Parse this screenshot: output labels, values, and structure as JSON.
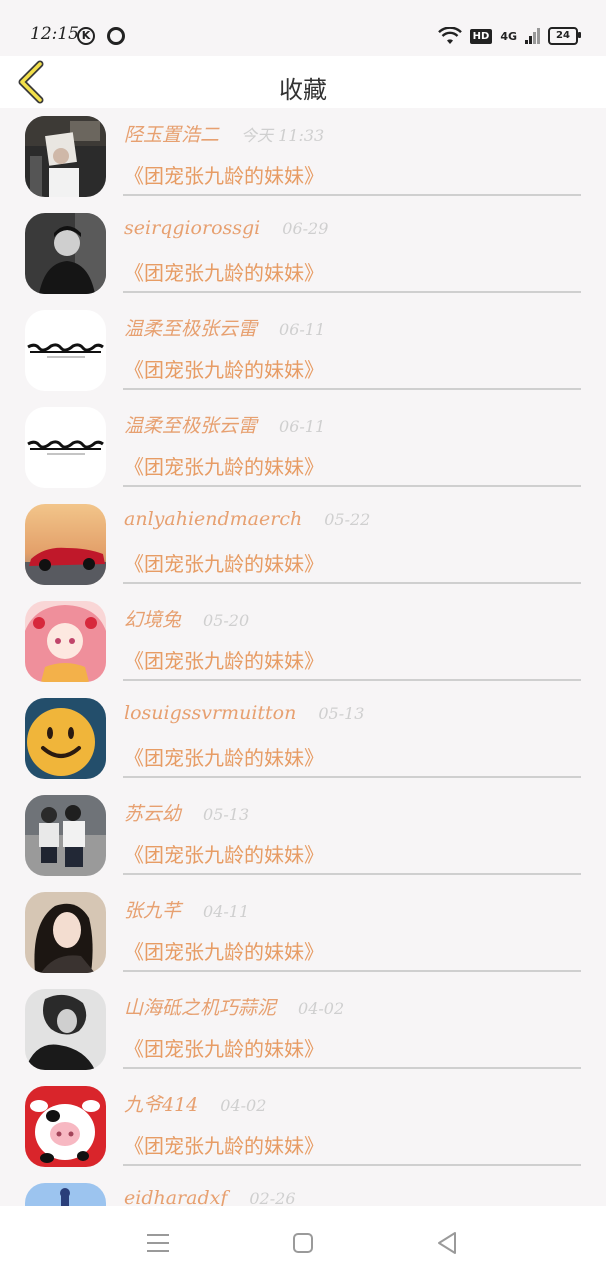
{
  "status": {
    "time": "12:15",
    "k_label": "K",
    "hd": "HD",
    "network": "4G",
    "battery": "24"
  },
  "header": {
    "title": "收藏"
  },
  "items": [
    {
      "name": "陉玉置浩二",
      "date": "今天 11:33",
      "post": "《团宠张九龄的妹妹》",
      "avatar": {
        "icon": "photo-man-holding-poster",
        "bg": "#2b2b2b"
      }
    },
    {
      "name": "seirqgiorossgi",
      "date": "06-29",
      "post": "《团宠张九龄的妹妹》",
      "avatar": {
        "icon": "photo-bw-man",
        "bg": "#333333"
      }
    },
    {
      "name": "温柔至极张云雷",
      "date": "06-11",
      "post": "《团宠张九龄的妹妹》",
      "avatar": {
        "icon": "calligraphy-logo",
        "bg": "#ffffff"
      }
    },
    {
      "name": "温柔至极张云雷",
      "date": "06-11",
      "post": "《团宠张九龄的妹妹》",
      "avatar": {
        "icon": "calligraphy-logo",
        "bg": "#ffffff"
      }
    },
    {
      "name": "anlyahiendmaerch",
      "date": "05-22",
      "post": "《团宠张九龄的妹妹》",
      "avatar": {
        "icon": "photo-red-car-sunset",
        "bg": "#e8b27a"
      }
    },
    {
      "name": "幻境兔",
      "date": "05-20",
      "post": "《团宠张九龄的妹妹》",
      "avatar": {
        "icon": "anime-girl-pink-hair",
        "bg": "#f6c2c6"
      }
    },
    {
      "name": "losuigssvrmuitton",
      "date": "05-13",
      "post": "《团宠张九龄的妹妹》",
      "avatar": {
        "icon": "smiley-cookie",
        "bg": "#2a6a8c"
      }
    },
    {
      "name": "苏云幼",
      "date": "05-13",
      "post": "《团宠张九龄的妹妹》",
      "avatar": {
        "icon": "photo-couple-street",
        "bg": "#8f8f8f"
      }
    },
    {
      "name": "张九芊",
      "date": "04-11",
      "post": "《团宠张九龄的妹妹》",
      "avatar": {
        "icon": "photo-woman-portrait",
        "bg": "#c9b9a5"
      }
    },
    {
      "name": "山海砥之机巧蒜泥",
      "date": "04-02",
      "post": "《团宠张九龄的妹妹》",
      "avatar": {
        "icon": "photo-bw-woman",
        "bg": "#d8d8d8"
      }
    },
    {
      "name": "九爷414",
      "date": "04-02",
      "post": "《团宠张九龄的妹妹》",
      "avatar": {
        "icon": "cartoon-cow-pig",
        "bg": "#d9252b"
      }
    },
    {
      "name": "eidharadxf",
      "date": "02-26",
      "post": "",
      "avatar": {
        "icon": "photo-blue-sky-dome",
        "bg": "#9cc4ef"
      }
    }
  ],
  "nav": {
    "menu_icon": "menu-icon",
    "home_icon": "home-square-icon",
    "back_icon": "back-triangle-icon"
  }
}
